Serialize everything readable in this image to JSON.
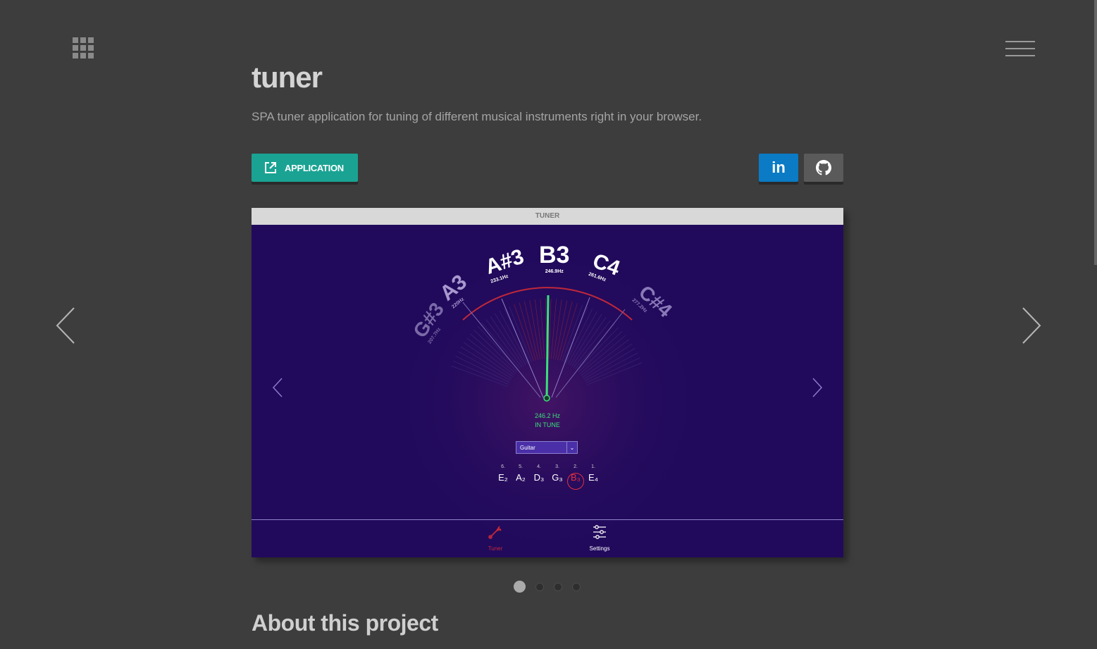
{
  "project": {
    "title": "tuner",
    "description": "SPA tuner application for tuning of different musical instruments right in your browser."
  },
  "buttons": {
    "application_label": "APPLICATION",
    "linkedin_label": "in"
  },
  "screenshot": {
    "window_title": "TUNER",
    "frequency": "246.2 Hz",
    "status": "IN TUNE",
    "instrument": "Guitar",
    "notes": [
      {
        "name": "G#3",
        "freq": "207.7Hz"
      },
      {
        "name": "A3",
        "freq": "220Hz"
      },
      {
        "name": "A#3",
        "freq": "233.1Hz"
      },
      {
        "name": "B3",
        "freq": "246.9Hz"
      },
      {
        "name": "C4",
        "freq": "261.6Hz"
      },
      {
        "name": "C#4",
        "freq": "277.2Hz"
      }
    ],
    "strings": [
      {
        "num": "6.",
        "note": "E₂"
      },
      {
        "num": "5.",
        "note": "A₂"
      },
      {
        "num": "4.",
        "note": "D₃"
      },
      {
        "num": "3.",
        "note": "G₃"
      },
      {
        "num": "2.",
        "note": "B₃",
        "active": true
      },
      {
        "num": "1.",
        "note": "E₄"
      }
    ],
    "toolbar": {
      "tuner_label": "Tuner",
      "settings_label": "Settings"
    }
  },
  "carousel": {
    "total_slides": 4,
    "active_slide": 1
  },
  "section": {
    "about_heading": "About this project"
  },
  "colors": {
    "background": "#3d3d3d",
    "accent_teal": "#1aa393",
    "linkedin_blue": "#0a7bc4",
    "tuner_bg": "#210a5c",
    "in_tune_green": "#3ae07a",
    "active_red": "#e03040"
  },
  "icons": {
    "apps": "grid-icon",
    "menu": "hamburger-icon",
    "external": "external-link-icon",
    "github": "github-icon",
    "prev": "chevron-left-icon",
    "next": "chevron-right-icon",
    "tuner": "tuning-fork-icon",
    "settings": "sliders-icon"
  }
}
